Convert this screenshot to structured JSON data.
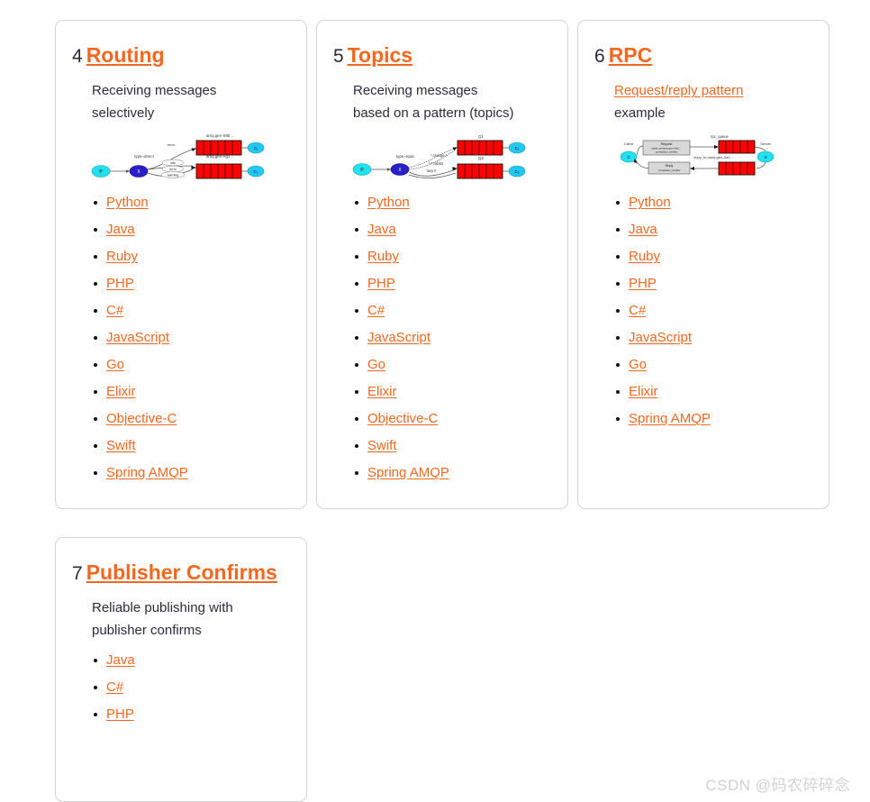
{
  "page": {
    "background_color": "#ffffff",
    "link_color": "#f4671f",
    "text_color": "#2b2b3c",
    "card_border_color": "#d4d4d4"
  },
  "watermark": {
    "text": "CSDN @码农碎碎念"
  },
  "tutorials": [
    {
      "number": "4",
      "title": "Routing",
      "description_plain": "Receiving messages selectively",
      "description_link": "",
      "description_rest": "Receiving messages selectively",
      "diagram": {
        "name": "routing-direct-exchange-diagram",
        "producer_label": "P",
        "exchange_label": "X",
        "exchange_type_label": "type=direct",
        "binding_keys": [
          "error",
          "info",
          "error",
          "warning"
        ],
        "queue_labels": [
          "amq.gen-S9b...",
          "amq.gen-Ag1..."
        ],
        "consumer_labels": [
          "C₁",
          "C₂"
        ]
      },
      "languages": [
        "Python",
        "Java",
        "Ruby",
        "PHP",
        "C#",
        "JavaScript",
        "Go",
        "Elixir",
        "Objective-C",
        "Swift",
        "Spring AMQP"
      ]
    },
    {
      "number": "5",
      "title": "Topics",
      "description_plain": "Receiving messages based on a pattern (topics)",
      "description_link": "",
      "description_rest": "Receiving messages based on a pattern (topics)",
      "diagram": {
        "name": "topics-topic-exchange-diagram",
        "producer_label": "P",
        "exchange_label": "X",
        "exchange_type_label": "type=topic",
        "binding_keys": [
          "*.orange.*",
          "*.*.rabbit",
          "lazy.#"
        ],
        "queue_labels": [
          "Q1",
          "Q2"
        ],
        "consumer_labels": [
          "C₁",
          "C₂"
        ]
      },
      "languages": [
        "Python",
        "Java",
        "Ruby",
        "PHP",
        "C#",
        "JavaScript",
        "Go",
        "Elixir",
        "Objective-C",
        "Swift",
        "Spring AMQP"
      ]
    },
    {
      "number": "6",
      "title": "RPC",
      "description_plain": "Request/reply pattern example",
      "description_link": "Request/reply pattern",
      "description_rest": " example",
      "diagram": {
        "name": "rpc-request-reply-diagram",
        "client_label": "Client",
        "client_node": "C",
        "server_label": "Server",
        "server_node": "S",
        "request_box": "Request\nreply_to=amqp.gen-Xa2...\ncorrelation_id=abc",
        "reply_box": "Reply\ncorrelation_id=abc",
        "queue_labels": [
          "rpc_queue",
          "reply_to=amq.gen-Xa2..."
        ]
      },
      "languages": [
        "Python",
        "Java",
        "Ruby",
        "PHP",
        "C#",
        "JavaScript",
        "Go",
        "Elixir",
        "Spring AMQP"
      ]
    },
    {
      "number": "7",
      "title": "Publisher Confirms",
      "description_plain": "Reliable publishing with publisher confirms",
      "description_link": "",
      "description_rest": "Reliable publishing with publisher confirms",
      "diagram": null,
      "languages": [
        "Java",
        "C#",
        "PHP"
      ]
    }
  ]
}
